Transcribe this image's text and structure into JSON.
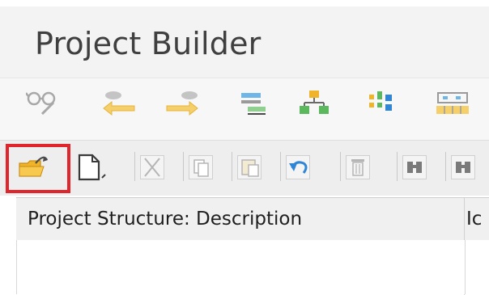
{
  "window": {
    "title": "Project Builder"
  },
  "toolbar1": {
    "icons": [
      "glasses-edit-icon",
      "arrow-left-icon",
      "arrow-right-icon",
      "layout-bars-icon",
      "org-chart-icon",
      "grid-nodes-icon",
      "transport-icon"
    ]
  },
  "toolbar2": {
    "icons": [
      "open-folder-icon",
      "new-document-icon",
      "cut-icon",
      "copy-icon",
      "paste-icon",
      "undo-icon",
      "delete-icon",
      "find-icon",
      "find-next-icon"
    ],
    "highlighted_icon": "open-folder-icon"
  },
  "table": {
    "columns": [
      "Project Structure: Description",
      "Ic"
    ]
  },
  "colors": {
    "highlight": "#e0262c",
    "accent_yellow": "#f0b429",
    "accent_green": "#3aa84a",
    "accent_blue": "#2f86d6"
  }
}
